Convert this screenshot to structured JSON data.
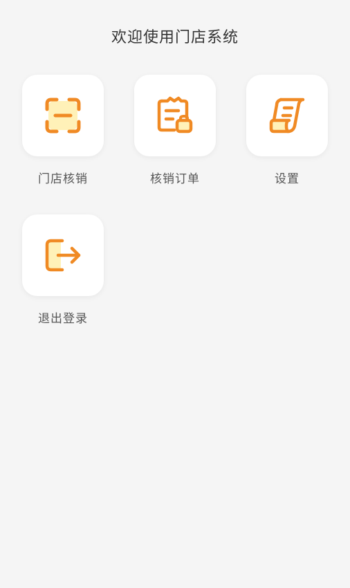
{
  "header": {
    "title": "欢迎使用门店系统"
  },
  "menu": {
    "items": [
      {
        "label": "门店核销",
        "icon": "scan-verify-icon"
      },
      {
        "label": "核销订单",
        "icon": "order-clipboard-icon"
      },
      {
        "label": "设置",
        "icon": "settings-scroll-icon"
      },
      {
        "label": "退出登录",
        "icon": "logout-icon"
      }
    ]
  },
  "colors": {
    "accent": "#f08a24",
    "accent_fill": "#fff1b8",
    "background": "#f5f5f5",
    "card": "#ffffff"
  }
}
